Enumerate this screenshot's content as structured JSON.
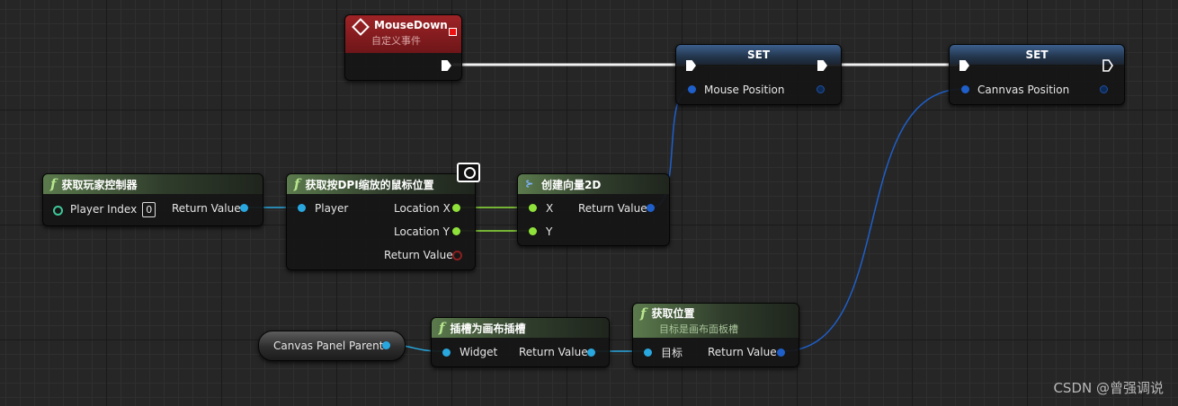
{
  "event_node": {
    "title": "MouseDown",
    "subtitle": "自定义事件"
  },
  "set_mouse": {
    "title": "SET",
    "var": "Mouse Position"
  },
  "set_canvas": {
    "title": "SET",
    "var": "Cannvas Position"
  },
  "get_controller": {
    "title": "获取玩家控制器",
    "in_label": "Player Index",
    "in_value": "0",
    "out_label": "Return Value"
  },
  "get_mouse_pos": {
    "title": "获取按DPI缩放的鼠标位置",
    "in_label": "Player",
    "out_x": "Location X",
    "out_y": "Location Y",
    "out_rv": "Return Value"
  },
  "make_vector": {
    "title": "创建向量2D",
    "in_x": "X",
    "in_y": "Y",
    "out_label": "Return Value"
  },
  "canvas_ref": {
    "label": "Canvas Panel Parent"
  },
  "slot_as": {
    "title": "插槽为画布插槽",
    "in_label": "Widget",
    "out_label": "Return Value"
  },
  "get_position": {
    "title": "获取位置",
    "subtitle": "目标是画布面板槽",
    "in_label": "目标",
    "out_label": "Return Value"
  },
  "watermark": "CSDN @曾强调说",
  "colors": {
    "struct_pin": "#1f5fc9",
    "object_pin": "#29a8e0",
    "float_pin": "#8fe23a",
    "exec_wire": "#ffffff",
    "event_header": "#9e2326"
  }
}
